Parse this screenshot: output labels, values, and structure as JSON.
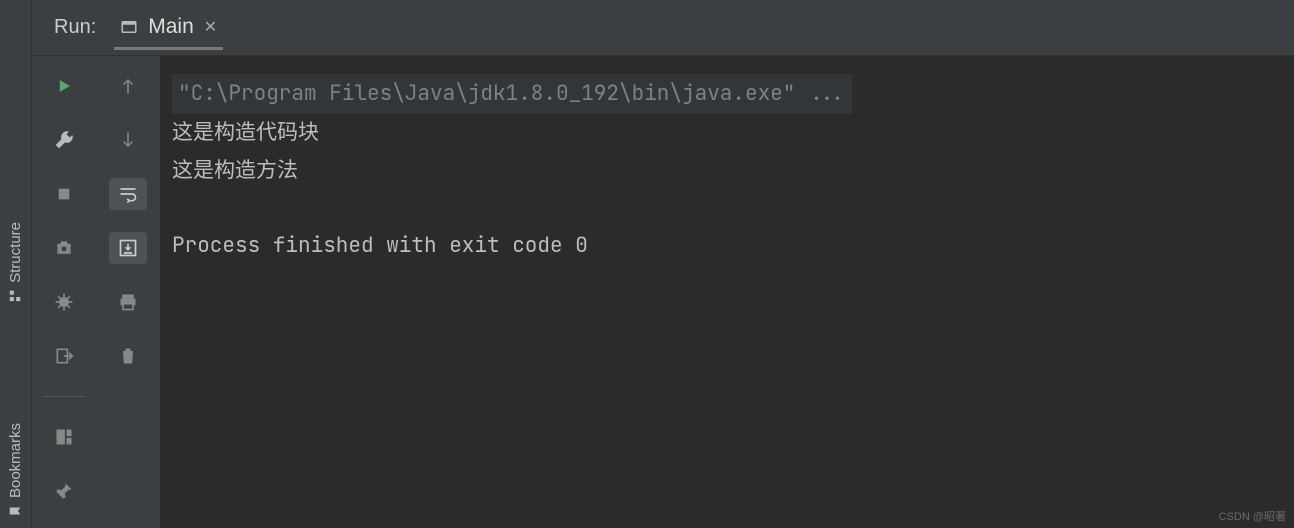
{
  "vtools": {
    "structure": "Structure",
    "bookmarks": "Bookmarks"
  },
  "header": {
    "title": "Run:",
    "tab": "Main",
    "close": "✕"
  },
  "icons": {
    "run": "play-icon",
    "wrench": "wrench-icon"
  },
  "console": {
    "cmd": "\"C:\\Program Files\\Java\\jdk1.8.0_192\\bin\\java.exe\" ...",
    "line1": "这是构造代码块",
    "line2": "这是构造方法",
    "exit": "Process finished with exit code 0"
  },
  "watermark": "CSDN @昭著"
}
